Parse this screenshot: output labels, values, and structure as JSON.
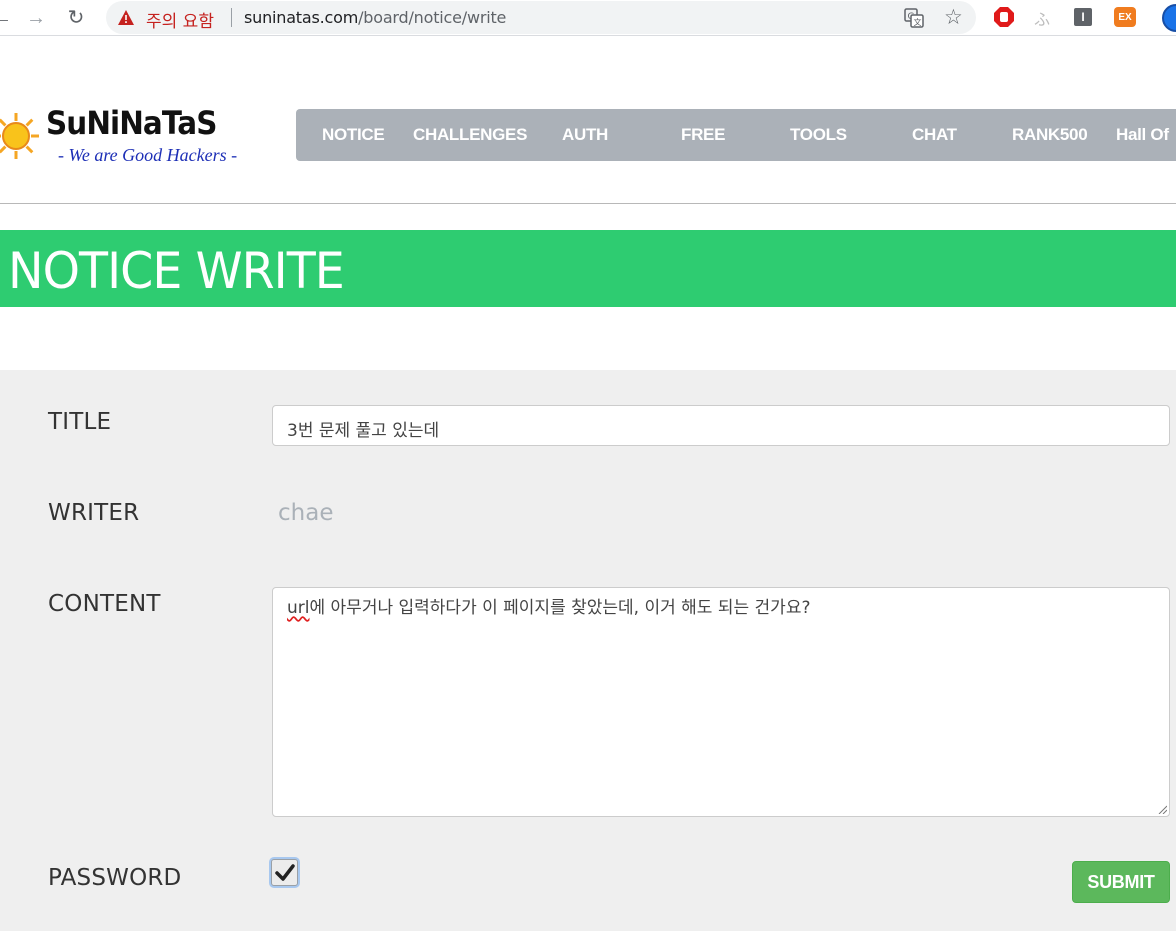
{
  "browser": {
    "security_warning": "주의 요함",
    "url_host": "suninatas.com",
    "url_path": "/board/notice/write"
  },
  "site": {
    "logo_title": "SuNiNaTaS",
    "logo_tagline": "- We are Good Hackers -",
    "nav_items": [
      "NOTICE",
      "CHALLENGES",
      "AUTH",
      "FREE",
      "TOOLS",
      "CHAT",
      "RANK500",
      "Hall Of"
    ]
  },
  "page": {
    "title": "NOTICE WRITE"
  },
  "form": {
    "title_label": "TITLE",
    "title_value": "3번 문제 풀고 있는데",
    "writer_label": "WRITER",
    "writer_value": "chae",
    "content_label": "CONTENT",
    "content_spell_word": "url",
    "content_rest": "에 아무거나 입력하다가 이 페이지를 찾았는데, 이거 해도 되는 건가요?",
    "password_label": "PASSWORD",
    "password_checked": true,
    "submit_label": "SUBMIT"
  },
  "colors": {
    "title_band": "#2ecc71",
    "nav_background": "#abb1b8",
    "form_background": "#efefef",
    "submit_button": "#5cb85c",
    "warning_text": "#c5221f"
  }
}
